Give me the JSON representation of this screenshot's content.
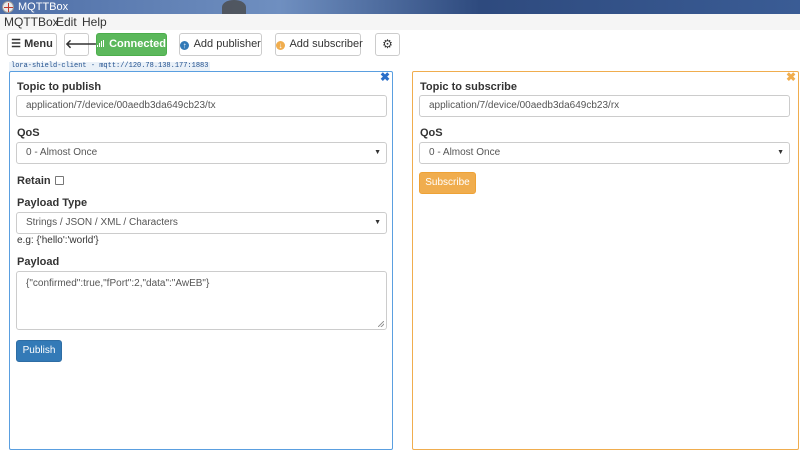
{
  "window": {
    "title": "MQTTBox"
  },
  "menubar": {
    "items": [
      "MQTTBox",
      "Edit",
      "Help"
    ]
  },
  "toolbar": {
    "menu_label": "Menu",
    "connected_label": "Connected",
    "add_publisher_label": "Add publisher",
    "add_subscriber_label": "Add subscriber"
  },
  "connection_label": "lora-shield-client - mqtt://120.78.138.177:1883",
  "publisher": {
    "topic_label": "Topic to publish",
    "topic_value": "application/7/device/00aedb3da649cb23/tx",
    "qos_label": "QoS",
    "qos_value": "0 - Almost Once",
    "retain_label": "Retain",
    "payload_type_label": "Payload Type",
    "payload_type_value": "Strings / JSON / XML / Characters",
    "payload_hint": "e.g: {'hello':'world'}",
    "payload_label": "Payload",
    "payload_value": "{\"confirmed\":true,\"fPort\":2,\"data\":\"AwEB\"}",
    "publish_label": "Publish"
  },
  "subscriber": {
    "topic_label": "Topic to subscribe",
    "topic_value": "application/7/device/00aedb3da649cb23/rx",
    "qos_label": "QoS",
    "qos_value": "0 - Almost Once",
    "subscribe_label": "Subscribe"
  },
  "colors": {
    "connected": "#5cb85c",
    "publish": "#337ab7",
    "subscribe": "#f0ad4e"
  },
  "icons": [
    "app-icon",
    "menu-icon",
    "back-arrow-icon",
    "signal-icon",
    "add-publisher-icon",
    "add-subscriber-icon",
    "gear-icon",
    "close-icon",
    "chevron-down-icon"
  ]
}
